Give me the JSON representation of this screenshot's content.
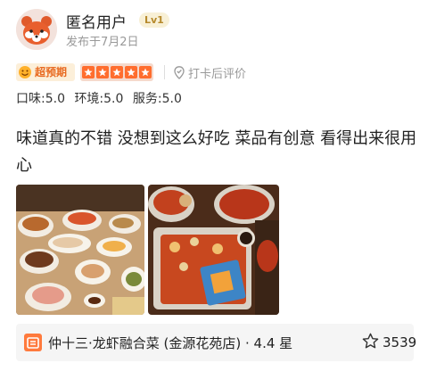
{
  "user": {
    "name": "匿名用户",
    "level": "Lv1",
    "posted": "发布于7月2日"
  },
  "rating": {
    "badge": "超预期",
    "stars": 5,
    "checkin_label": "打卡后评价"
  },
  "scores": {
    "taste": "口味:5.0",
    "environment": "环境:5.0",
    "service": "服务:5.0"
  },
  "review_text": "味道真的不错 没想到这么好吃 菜品有创意 看得出来很用心",
  "photos": [
    "dishes-table",
    "crayfish-platter"
  ],
  "place": {
    "name_rating": "仲十三·龙虾融合菜 (金源花苑店) · 4.4 星",
    "likes": "3539"
  },
  "colors": {
    "accent": "#ff6d2e",
    "level_bg": "#f8f0d6",
    "level_text": "#b68a2c",
    "muted": "#999999"
  }
}
